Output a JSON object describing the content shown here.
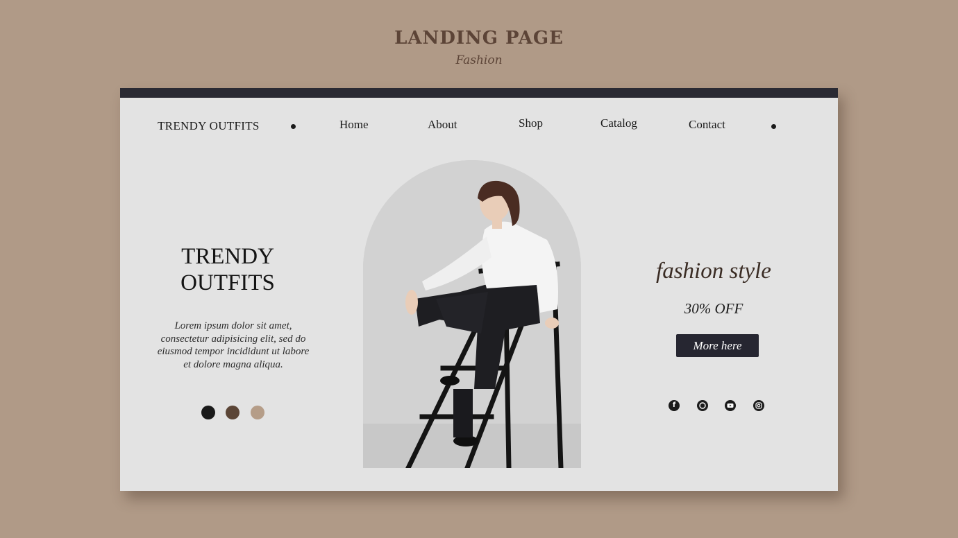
{
  "header": {
    "title": "LANDING PAGE",
    "subtitle": "Fashion"
  },
  "colors": {
    "background": "#b09a87",
    "card": "#e3e3e3",
    "topbar": "#2a2a33",
    "accent_text": "#5c4437",
    "button": "#262631"
  },
  "nav": {
    "brand": "TRENDY OUTFITS",
    "items": [
      "Home",
      "About",
      "Shop",
      "Catalog",
      "Contact"
    ]
  },
  "hero": {
    "title_line1": "TRENDY",
    "title_line2": "OUTFITS",
    "description": "Lorem ipsum dolor sit amet, consectetur adipisicing elit, sed do eiusmod tempor incididunt ut labore et dolore magna aliqua.",
    "swatches": [
      "#1a1a1a",
      "#5b4536",
      "#b59d88"
    ]
  },
  "promo": {
    "title": "fashion style",
    "discount": "30% OFF",
    "button_label": "More here"
  },
  "social": {
    "icons": [
      "facebook-icon",
      "whatsapp-icon",
      "youtube-icon",
      "instagram-icon"
    ]
  }
}
